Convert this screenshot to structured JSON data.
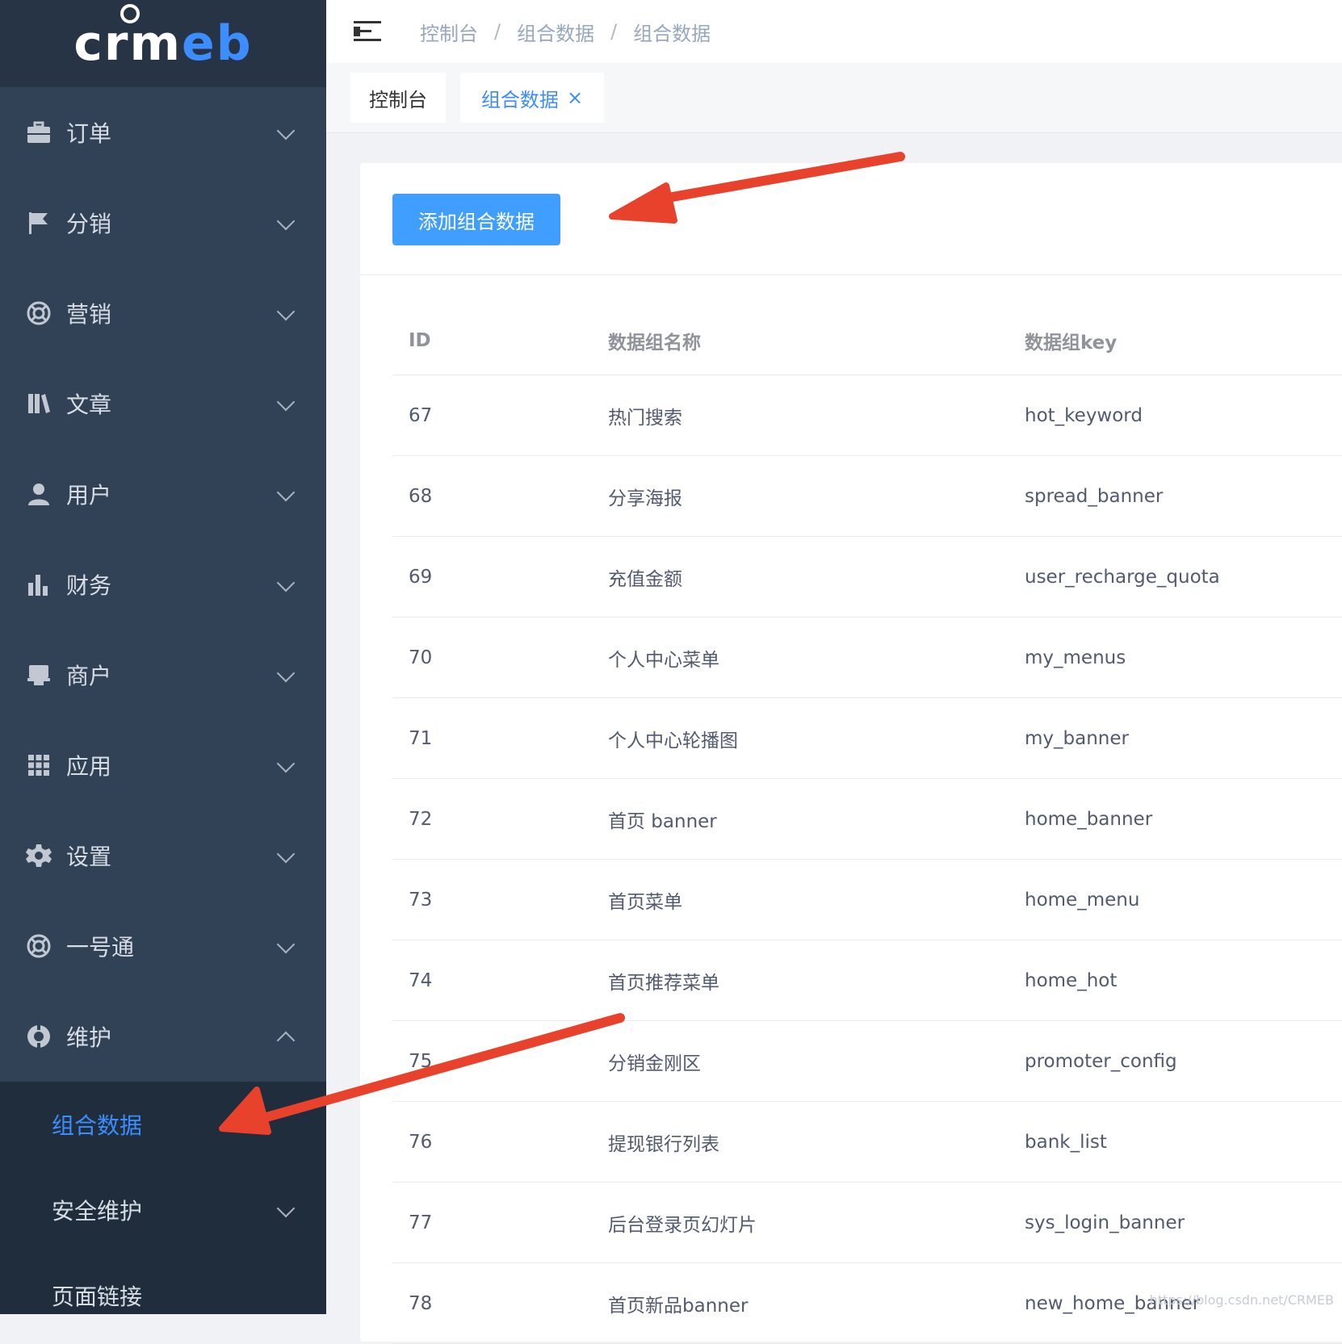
{
  "logo": {
    "main": "crm",
    "accent": "eb"
  },
  "sidebar": {
    "items": [
      {
        "label": "订单",
        "icon": "briefcase-icon"
      },
      {
        "label": "分销",
        "icon": "flag-icon"
      },
      {
        "label": "营销",
        "icon": "lifebuoy-icon"
      },
      {
        "label": "文章",
        "icon": "library-icon"
      },
      {
        "label": "用户",
        "icon": "user-icon"
      },
      {
        "label": "财务",
        "icon": "bar-chart-icon"
      },
      {
        "label": "商户",
        "icon": "store-icon"
      },
      {
        "label": "应用",
        "icon": "grid-icon"
      },
      {
        "label": "设置",
        "icon": "gear-icon"
      },
      {
        "label": "一号通",
        "icon": "lifebuoy-icon"
      },
      {
        "label": "维护",
        "icon": "maintenance-icon"
      }
    ],
    "submenu": [
      {
        "label": "组合数据",
        "active": true
      },
      {
        "label": "安全维护",
        "active": false
      },
      {
        "label": "页面链接",
        "active": false
      }
    ]
  },
  "header": {
    "breadcrumb": [
      "控制台",
      "组合数据",
      "组合数据"
    ],
    "separator": "/"
  },
  "tabs": [
    {
      "label": "控制台"
    },
    {
      "label": "组合数据",
      "close": "×"
    }
  ],
  "content": {
    "add_button": "添加组合数据",
    "table": {
      "headers": [
        "ID",
        "数据组名称",
        "数据组key"
      ],
      "rows": [
        [
          "67",
          "热门搜索",
          "hot_keyword"
        ],
        [
          "68",
          "分享海报",
          "spread_banner"
        ],
        [
          "69",
          "充值金额",
          "user_recharge_quota"
        ],
        [
          "70",
          "个人中心菜单",
          "my_menus"
        ],
        [
          "71",
          "个人中心轮播图",
          "my_banner"
        ],
        [
          "72",
          "首页 banner",
          "home_banner"
        ],
        [
          "73",
          "首页菜单",
          "home_menu"
        ],
        [
          "74",
          "首页推荐菜单",
          "home_hot"
        ],
        [
          "75",
          "分销金刚区",
          "promoter_config"
        ],
        [
          "76",
          "提现银行列表",
          "bank_list"
        ],
        [
          "77",
          "后台登录页幻灯片",
          "sys_login_banner"
        ],
        [
          "78",
          "首页新品banner",
          "new_home_banner"
        ]
      ]
    }
  },
  "watermark": "https://blog.csdn.net/CRMEB",
  "colors": {
    "sidebar": "#314156",
    "submenu": "#1f2d3d",
    "accent": "#409eff",
    "arrow": "#e8412c"
  }
}
